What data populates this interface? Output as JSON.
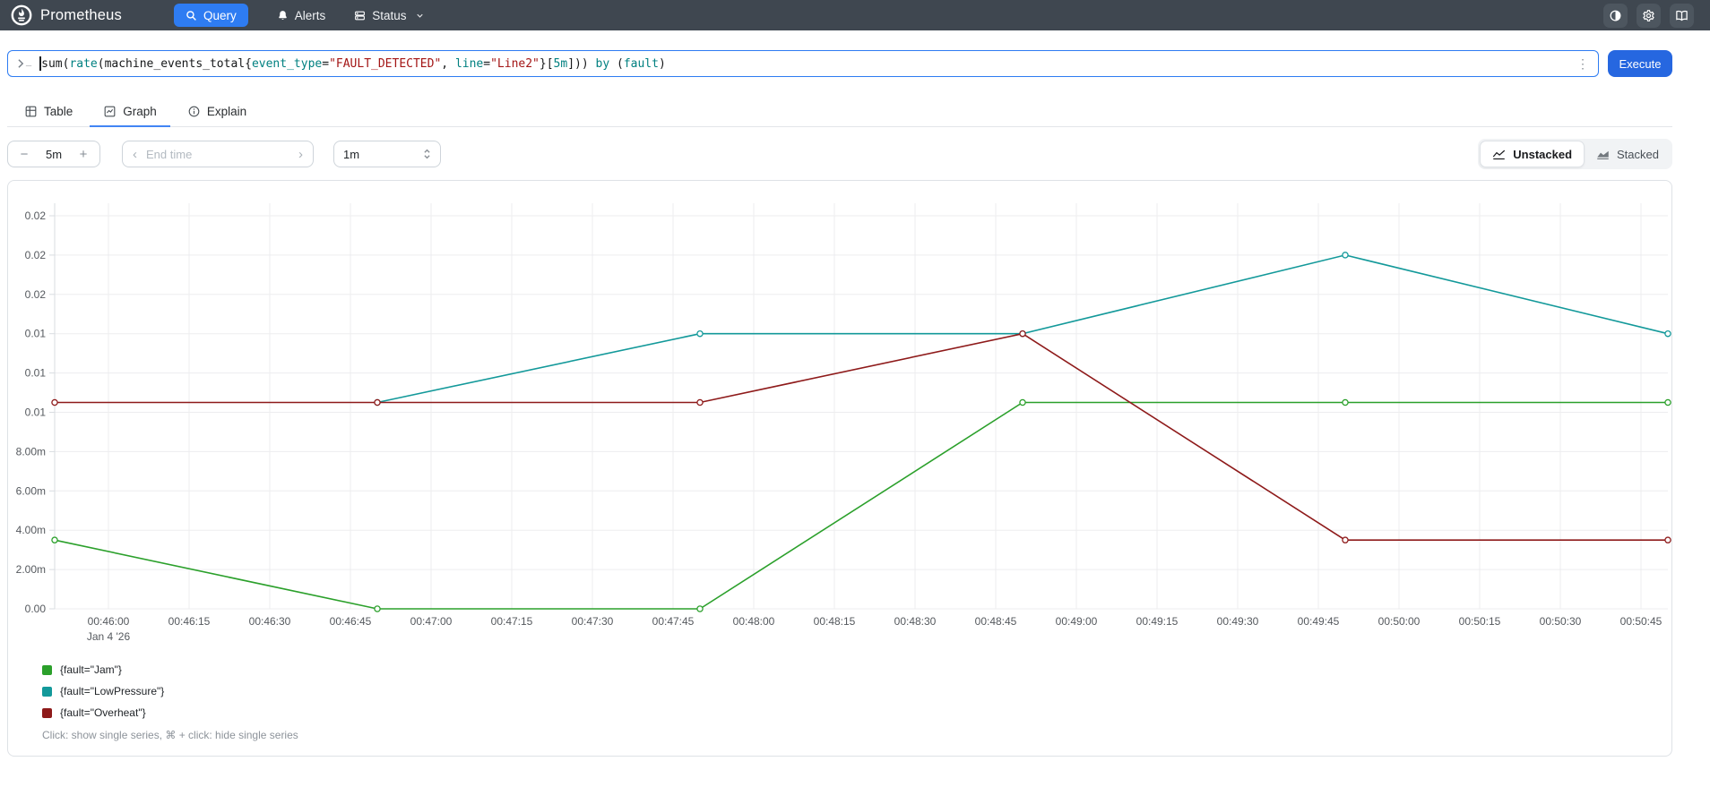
{
  "colors": {
    "navbar_bg": "#3f4750",
    "navbar_icon_bg": "#4d565f",
    "accent": "#2e7cf2",
    "execute_bg": "#2667e0",
    "panel_border": "#dee2e6",
    "grid": "#ededef",
    "axis_line": "#d9dde1",
    "tick_text": "#55595e",
    "token_keyword": "#008080",
    "token_string": "#a31515",
    "token_plain": "#16181a"
  },
  "navbar": {
    "brand": "Prometheus",
    "query_label": "Query",
    "alerts_label": "Alerts",
    "status_label": "Status",
    "right_icons": [
      "theme-toggle-icon",
      "settings-icon",
      "docs-icon"
    ]
  },
  "query": {
    "tokens": [
      {
        "text": "sum",
        "type": "name"
      },
      {
        "text": "(",
        "type": "punct"
      },
      {
        "text": "rate",
        "type": "func"
      },
      {
        "text": "(",
        "type": "punct"
      },
      {
        "text": "machine_events_total",
        "type": "name"
      },
      {
        "text": "{",
        "type": "punct"
      },
      {
        "text": "event_type",
        "type": "label"
      },
      {
        "text": "=",
        "type": "punct"
      },
      {
        "text": "\"FAULT_DETECTED\"",
        "type": "string"
      },
      {
        "text": ", ",
        "type": "punct"
      },
      {
        "text": "line",
        "type": "label"
      },
      {
        "text": "=",
        "type": "punct"
      },
      {
        "text": "\"Line2\"",
        "type": "string"
      },
      {
        "text": "}",
        "type": "punct"
      },
      {
        "text": "[",
        "type": "punct"
      },
      {
        "text": "5m",
        "type": "duration"
      },
      {
        "text": "]",
        "type": "punct"
      },
      {
        "text": ")) ",
        "type": "punct"
      },
      {
        "text": "by",
        "type": "keyword"
      },
      {
        "text": " (",
        "type": "punct"
      },
      {
        "text": "fault",
        "type": "label"
      },
      {
        "text": ")",
        "type": "punct"
      }
    ],
    "execute_label": "Execute"
  },
  "tabs": {
    "table": "Table",
    "graph": "Graph",
    "explain": "Explain",
    "active": "graph"
  },
  "controls": {
    "range_minus": "−",
    "range_value": "5m",
    "range_plus": "+",
    "end_time_placeholder": "End time",
    "resolution_value": "1m",
    "unstacked_label": "Unstacked",
    "stacked_label": "Stacked",
    "stacking_active": "unstacked"
  },
  "chart_data": {
    "type": "line",
    "title": "",
    "xlabel": "",
    "ylabel": "",
    "grid": true,
    "legend_position": "bottom-left",
    "x_domain_sec": [
      0,
      300
    ],
    "x_date_sublabel": "Jan 4 '26",
    "x_ticks": [
      {
        "sec": 10,
        "label": "00:46:00",
        "sublabel": "Jan 4 '26"
      },
      {
        "sec": 25,
        "label": "00:46:15"
      },
      {
        "sec": 40,
        "label": "00:46:30"
      },
      {
        "sec": 55,
        "label": "00:46:45"
      },
      {
        "sec": 70,
        "label": "00:47:00"
      },
      {
        "sec": 85,
        "label": "00:47:15"
      },
      {
        "sec": 100,
        "label": "00:47:30"
      },
      {
        "sec": 115,
        "label": "00:47:45"
      },
      {
        "sec": 130,
        "label": "00:48:00"
      },
      {
        "sec": 145,
        "label": "00:48:15"
      },
      {
        "sec": 160,
        "label": "00:48:30"
      },
      {
        "sec": 175,
        "label": "00:48:45"
      },
      {
        "sec": 190,
        "label": "00:49:00"
      },
      {
        "sec": 205,
        "label": "00:49:15"
      },
      {
        "sec": 220,
        "label": "00:49:30"
      },
      {
        "sec": 235,
        "label": "00:49:45"
      },
      {
        "sec": 250,
        "label": "00:50:00"
      },
      {
        "sec": 265,
        "label": "00:50:15"
      },
      {
        "sec": 280,
        "label": "00:50:30"
      },
      {
        "sec": 295,
        "label": "00:50:45"
      }
    ],
    "ylim": [
      0,
      0.02
    ],
    "y_ticks": [
      {
        "v": 0.02,
        "label": "0.02"
      },
      {
        "v": 0.018,
        "label": "0.02"
      },
      {
        "v": 0.016,
        "label": "0.02"
      },
      {
        "v": 0.014,
        "label": "0.01"
      },
      {
        "v": 0.012,
        "label": "0.01"
      },
      {
        "v": 0.01,
        "label": "0.01"
      },
      {
        "v": 0.008,
        "label": "8.00m"
      },
      {
        "v": 0.006,
        "label": "6.00m"
      },
      {
        "v": 0.004,
        "label": "4.00m"
      },
      {
        "v": 0.002,
        "label": "2.00m"
      },
      {
        "v": 0.0,
        "label": "0.00"
      }
    ],
    "samples_sec": [
      0,
      60,
      120,
      180,
      240,
      300
    ],
    "series": [
      {
        "name": "{fault=\"Jam\"}",
        "color": "#2ba02b",
        "values": [
          0.0035,
          0,
          0,
          0.0105,
          0.0105,
          0.0105
        ]
      },
      {
        "name": "{fault=\"LowPressure\"}",
        "color": "#13999a",
        "values": [
          null,
          0.0105,
          0.014,
          0.014,
          0.018,
          0.014
        ]
      },
      {
        "name": "{fault=\"Overheat\"}",
        "color": "#8e1a1a",
        "values": [
          0.0105,
          0.0105,
          0.0105,
          0.014,
          0.0035,
          0.0035
        ]
      }
    ],
    "footer_hint": "Click: show single series, ⌘ + click: hide single series"
  }
}
